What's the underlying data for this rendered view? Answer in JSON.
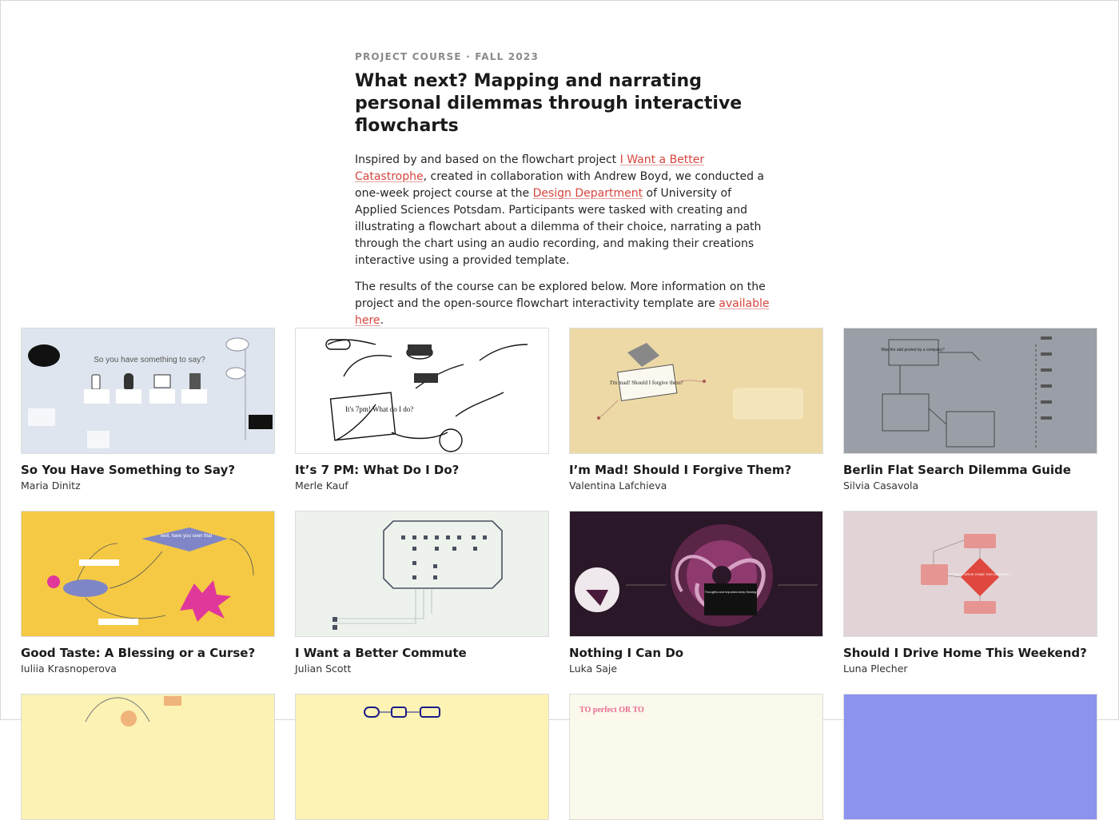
{
  "header": {
    "eyebrow": "PROJECT COURSE · FALL 2023",
    "title": "What next? Mapping and narrating personal dilemmas through interactive flowcharts"
  },
  "intro": {
    "p1_a": "Inspired by and based on the flowchart project ",
    "p1_link1": "I Want a Better Catastrophe",
    "p1_b": ", created in collaboration with Andrew Boyd, we conducted a one-week project course at the ",
    "p1_link2": "Design Department",
    "p1_c": " of University of Applied Sciences Potsdam. Participants were tasked with creating and illustrating a flowchart about a dilemma of their choice, narrating a path through the chart using an audio recording, and making their creations interactive using a provided template.",
    "p2_a": "The results of the course can be explored below. More information on the project and the open-source flowchart interactivity template are ",
    "p2_link": "available here",
    "p2_b": "."
  },
  "projects": [
    {
      "title": "So You Have Something to Say?",
      "author": "Maria Dinitz",
      "bg": "#dfe5ee",
      "thumb_text": "So you have something to say?"
    },
    {
      "title": "It’s 7 PM: What Do I Do?",
      "author": "Merle Kauf",
      "bg": "#ffffff",
      "thumb_text": "It's 7pm! What do I do?"
    },
    {
      "title": "I’m Mad! Should I Forgive Them?",
      "author": "Valentina Lafchieva",
      "bg": "#ecd9a6",
      "thumb_text": "I'm mad! Should I forgive them?"
    },
    {
      "title": "Berlin Flat Search Dilemma Guide",
      "author": "Silvia Casavola",
      "bg": "#9a9ea6",
      "thumb_text": "Was the add posted by a company?"
    },
    {
      "title": "Good Taste: A Blessing or a Curse?",
      "author": "Iuliia Krasnoperova",
      "bg": "#f5c944",
      "thumb_text": "well, have you seen that"
    },
    {
      "title": "I Want a Better Commute",
      "author": "Julian Scott",
      "bg": "#eef2ec",
      "thumb_text": ""
    },
    {
      "title": "Nothing I Can Do",
      "author": "Luka Saje",
      "bg": "#2a1727",
      "thumb_text": "Thoughts and impulses keep flowing"
    },
    {
      "title": "Should I Drive Home This Weekend?",
      "author": "Luna Plecher",
      "bg": "#e2d4d6",
      "thumb_text": "SHOULD I DRIVE HOME THIS WEEKEND?"
    },
    {
      "title": "",
      "author": "",
      "bg": "#fbf2b3",
      "thumb_text": ""
    },
    {
      "title": "",
      "author": "",
      "bg": "#fdf3b4",
      "thumb_text": ""
    },
    {
      "title": "",
      "author": "",
      "bg": "#fbf8ec",
      "thumb_text": "TO perfect OR TO"
    },
    {
      "title": "",
      "author": "",
      "bg": "#8b93ef",
      "thumb_text": ""
    }
  ],
  "colors": {
    "link": "#d6453d",
    "muted": "#8a8a8a"
  }
}
